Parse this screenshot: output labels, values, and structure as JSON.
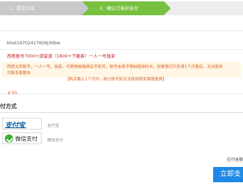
{
  "steps": [
    {
      "label": "1、提交订单"
    },
    {
      "label": "2、确认订单并支付"
    }
  ],
  "order": {
    "id": "khot14702417609j36bw",
    "product_name": "西席账号7000+部留道（1800+下载券）一人一号独享",
    "notice_line1": "西席文库账号，一人一号，独享，可更换邮箱绑定手机号，账号本身不限制使用时长，但是我们只负责1个月售后，无法使用",
    "notice_line2": "可联系客服协",
    "notice_line3": "【购买截止1个月内，部分账号如无法使用联系客服更换】",
    "price": "￥30"
  },
  "payment": {
    "title": "付方式",
    "options": [
      {
        "logo_text": "支付宝",
        "caption": "支付宝"
      },
      {
        "logo_text": "微信支付",
        "caption": "微信支付"
      }
    ],
    "amount_label": "应付金额",
    "pay_button": "立即支"
  },
  "colors": {
    "step_done": "#c9c9c9",
    "step_active": "#78c03f",
    "accent": "#1e88e5",
    "warning": "#d9611f",
    "price": "#e05a20"
  }
}
